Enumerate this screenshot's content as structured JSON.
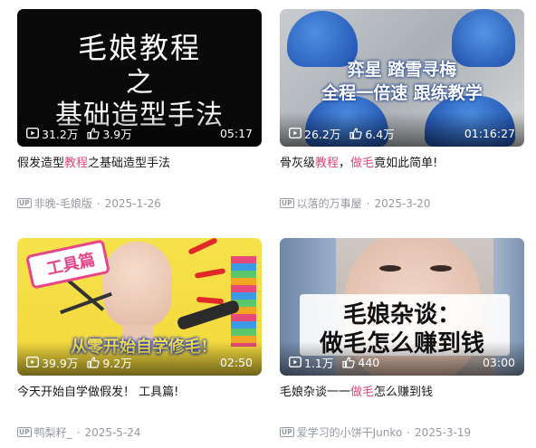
{
  "cards": [
    {
      "thumb_text": [
        "毛娘教程",
        "之",
        "基础造型手法"
      ],
      "views": "31.2万",
      "likes": "3.9万",
      "duration": "05:17",
      "title_pre": "假发造型",
      "title_kw": "教程",
      "title_post": "之基础造型手法",
      "up_label": "UP",
      "author": "非晚-毛娘版",
      "date": "2025-1-26"
    },
    {
      "thumb_text": [
        "弈星 踏雪寻梅",
        "全程一倍速 跟练教学"
      ],
      "views": "26.2万",
      "likes": "6.4万",
      "duration": "01:16:27",
      "title_pre": "骨灰级",
      "title_kw": "教程",
      "title_mid": "，",
      "title_kw2": "做毛",
      "title_post": "竟如此简单!",
      "up_label": "UP",
      "author": "以落的万事屋",
      "date": "2025-3-20"
    },
    {
      "thumb_text": [
        "工具篇",
        "从零开始自学修毛!"
      ],
      "views": "39.9万",
      "likes": "9.2万",
      "duration": "02:50",
      "title_pre": "今天开始自学做假发！ 工具篇!",
      "up_label": "UP",
      "author": "鸭梨籽_",
      "date": "2025-5-24"
    },
    {
      "thumb_text": [
        "毛娘杂谈：",
        "做毛怎么赚到钱"
      ],
      "views": "1.1万",
      "likes": "440",
      "duration": "03:00",
      "title_pre": "毛娘杂谈一一",
      "title_kw": "做毛",
      "title_post": "怎么赚到钱",
      "up_label": "UP",
      "author": "爱学习的小饼干Junko",
      "date": "2025-3-19"
    }
  ],
  "colors": {
    "keyword": "#e0457b",
    "meta": "#9499a0",
    "title": "#18191c"
  },
  "icons": [
    "play-count-icon",
    "like-icon",
    "up-badge-icon"
  ]
}
